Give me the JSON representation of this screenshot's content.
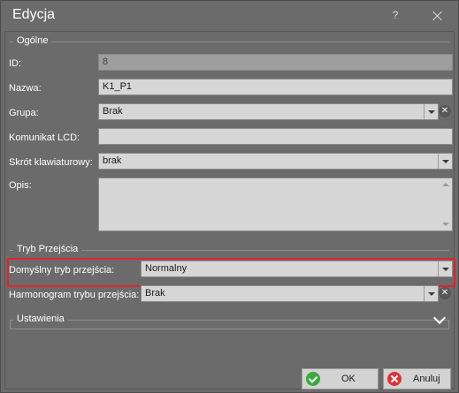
{
  "window": {
    "title": "Edycja",
    "help_label": "?"
  },
  "general": {
    "legend": "Ogólne",
    "id": {
      "label": "ID:",
      "value": "8"
    },
    "name": {
      "label": "Nazwa:",
      "value": "K1_P1"
    },
    "group": {
      "label": "Grupa:",
      "value": "Brak"
    },
    "lcd": {
      "label": "Komunikat LCD:",
      "value": ""
    },
    "shortcut": {
      "label": "Skrót klawiaturowy:",
      "value": "brak"
    },
    "description": {
      "label": "Opis:",
      "value": ""
    }
  },
  "passage_mode": {
    "legend": "Tryb Przejścia",
    "default_mode": {
      "label": "Domyślny tryb przejścia:",
      "value": "Normalny"
    },
    "schedule": {
      "label": "Harmonogram trybu przejścia:",
      "value": "Brak"
    }
  },
  "settings": {
    "legend": "Ustawienia",
    "collapsed": true
  },
  "buttons": {
    "ok": "OK",
    "cancel": "Anuluj"
  },
  "icons": {
    "close": "close-icon",
    "help": "help-icon",
    "dropdown": "chevron-down-icon",
    "clear": "clear-icon",
    "ok": "check-icon",
    "cancel": "cancel-icon"
  },
  "colors": {
    "highlight": "#e2222b",
    "ok_icon": "#3da83d",
    "cancel_icon": "#d9343a"
  }
}
